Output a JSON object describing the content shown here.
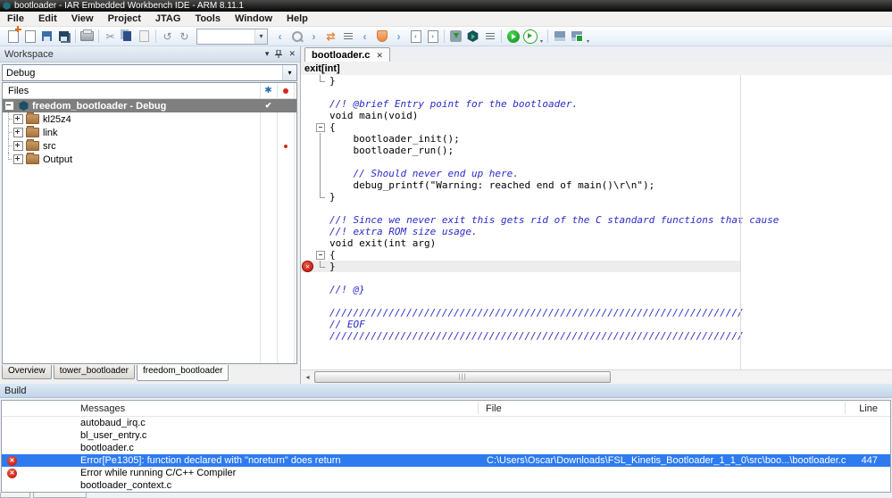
{
  "window": {
    "title": "bootloader - IAR Embedded Workbench IDE - ARM 8.11.1"
  },
  "menu": {
    "items": [
      "File",
      "Edit",
      "View",
      "Project",
      "JTAG",
      "Tools",
      "Window",
      "Help"
    ]
  },
  "toolbar": {
    "search_value": ""
  },
  "icons": {
    "dropdown": "▾",
    "close": "✕",
    "check": "✔",
    "gear": "✱",
    "cut": "✂",
    "undo": "↺",
    "redo": "↻",
    "swap": "⇄",
    "back": "‹",
    "forward": "›",
    "nav_prev": "‹",
    "nav_next": "›",
    "scroll_left": "◂",
    "grip": "|||",
    "err_x": "✕"
  },
  "workspace": {
    "title": "Workspace",
    "config_selector": "Debug",
    "files_header": "Files",
    "tree": [
      {
        "label": "freedom_bootloader - Debug"
      },
      {
        "label": "kl25z4"
      },
      {
        "label": "link"
      },
      {
        "label": "src"
      },
      {
        "label": "Output"
      }
    ],
    "tabs": [
      "Overview",
      "tower_bootloader",
      "freedom_bootloader"
    ]
  },
  "editor": {
    "tab": "bootloader.c",
    "context": "exit[int]",
    "lines": [
      "}",
      "",
      "//! @brief Entry point for the bootloader.",
      "void main(void)",
      "{",
      "    bootloader_init();",
      "    bootloader_run();",
      "",
      "    // Should never end up here.",
      "    debug_printf(\"Warning: reached end of main()\\r\\n\");",
      "}",
      "",
      "//! Since we never exit this gets rid of the C standard functions that cause",
      "//! extra ROM size usage.",
      "void exit(int arg)",
      "{",
      "}",
      "",
      "//! @}",
      "",
      "//////////////////////////////////////////////////////////////////////",
      "// EOF",
      "//////////////////////////////////////////////////////////////////////"
    ]
  },
  "build": {
    "title": "Build",
    "columns": {
      "messages": "Messages",
      "file": "File",
      "line": "Line"
    },
    "rows": [
      {
        "message": "autobaud_irq.c",
        "file": "",
        "line": ""
      },
      {
        "message": "bl_user_entry.c",
        "file": "",
        "line": ""
      },
      {
        "message": "bootloader.c",
        "file": "",
        "line": ""
      },
      {
        "message": "Error[Pe1305]: function declared with \"noreturn\" does return",
        "file": "C:\\Users\\Oscar\\Downloads\\FSL_Kinetis_Bootloader_1_1_0\\src\\boo...\\bootloader.c",
        "line": "447"
      },
      {
        "message": "Error while running C/C++ Compiler",
        "file": "",
        "line": ""
      },
      {
        "message": "bootloader_context.c",
        "file": "",
        "line": ""
      }
    ]
  },
  "colors": {
    "selection_blue": "#2e7bf0",
    "comment_blue": "#2a2ac8",
    "error_red": "#d42a1e",
    "tree_selected_gray": "#7f7f7f",
    "build_header_blue": "#cfdfee"
  }
}
